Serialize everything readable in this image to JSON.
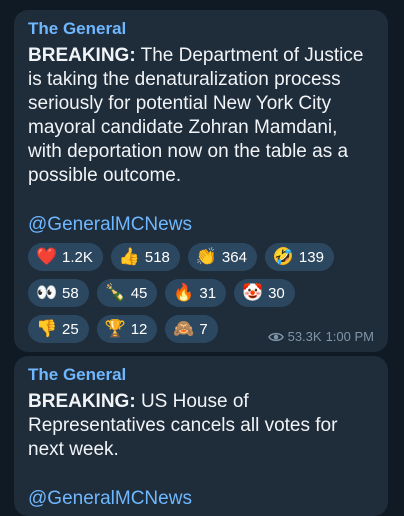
{
  "post1": {
    "channel": "The General",
    "breaking": "BREAKING:",
    "text": " The Department of Justice is taking the denaturalization process seriously for potential New York City mayoral candidate Zohran Mamdani, with deportation now on the table as a possible outcome.",
    "handle": "@GeneralMCNews",
    "reactions": [
      {
        "icon": "red-heart",
        "glyph": "❤️",
        "count": "1.2K"
      },
      {
        "icon": "thumbs-up",
        "glyph": "👍",
        "count": "518"
      },
      {
        "icon": "clapping-hands",
        "glyph": "👏",
        "count": "364"
      },
      {
        "icon": "rolling-laughing",
        "glyph": "🤣",
        "count": "139"
      },
      {
        "icon": "eyes",
        "glyph": "👀",
        "count": "58"
      },
      {
        "icon": "champagne",
        "glyph": "🍾",
        "count": "45"
      },
      {
        "icon": "fire",
        "glyph": "🔥",
        "count": "31"
      },
      {
        "icon": "clown",
        "glyph": "🤡",
        "count": "30"
      },
      {
        "icon": "thumbs-down",
        "glyph": "👎",
        "count": "25"
      },
      {
        "icon": "trophy",
        "glyph": "🏆",
        "count": "12"
      },
      {
        "icon": "see-no-evil-monkey",
        "glyph": "🙈",
        "count": "7"
      }
    ],
    "views": "53.3K",
    "time": "1:00 PM"
  },
  "post2": {
    "channel": "The General",
    "breaking": "BREAKING:",
    "text": " US House of Representatives cancels all votes for next week.",
    "handle": "@GeneralMCNews"
  },
  "colors": {
    "background": "#0f1a24",
    "bubble": "#1f2c3a",
    "accent": "#6fb7ff",
    "chip": "#2c4861"
  }
}
